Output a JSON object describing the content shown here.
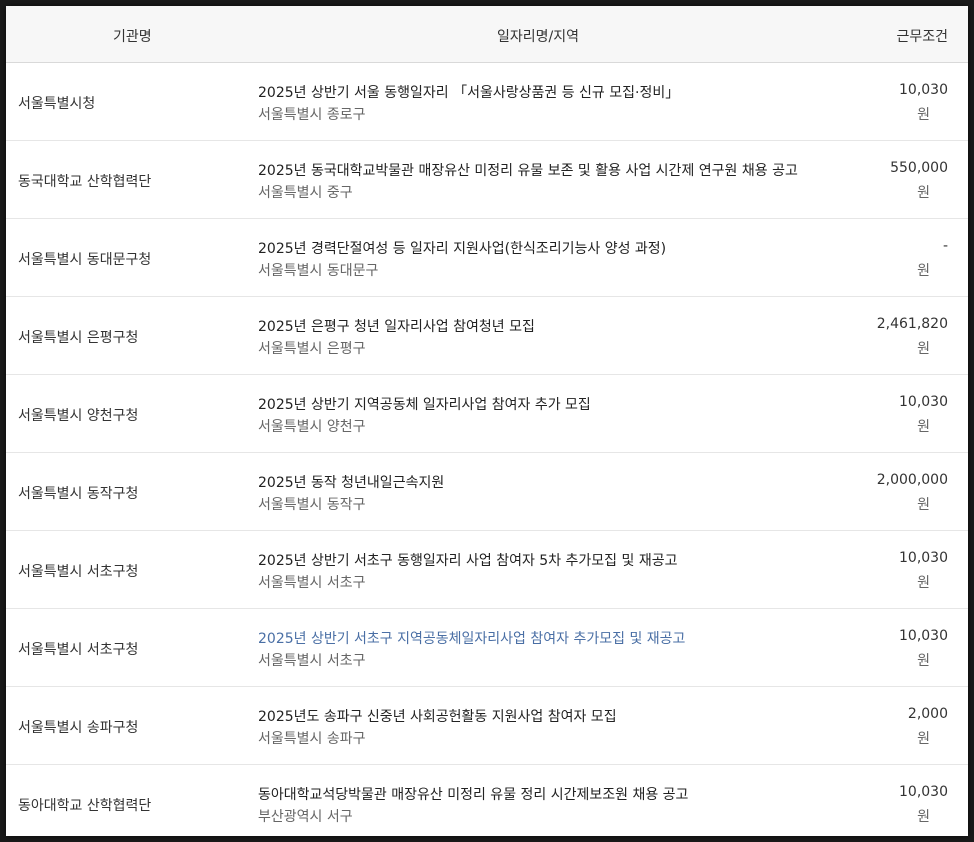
{
  "header": {
    "org": "기관명",
    "title": "일자리명/지역",
    "cond": "근무조건"
  },
  "rows": [
    {
      "org": "서울특별시청",
      "title": "2025년 상반기 서울 동행일자리 「서울사랑상품권 등 신규 모집·정비」",
      "region": "서울특별시 종로구",
      "amount": "10,030",
      "unit": "원"
    },
    {
      "org": "동국대학교 산학협력단",
      "title": "2025년 동국대학교박물관 매장유산 미정리 유물 보존 및 활용 사업 시간제 연구원 채용 공고",
      "region": "서울특별시 중구",
      "amount": "550,000",
      "unit": "원"
    },
    {
      "org": "서울특별시 동대문구청",
      "title": "2025년 경력단절여성 등 일자리 지원사업(한식조리기능사 양성 과정)",
      "region": "서울특별시 동대문구",
      "amount": "-",
      "unit": "원"
    },
    {
      "org": "서울특별시 은평구청",
      "title": "2025년 은평구 청년 일자리사업 참여청년 모집",
      "region": "서울특별시 은평구",
      "amount": "2,461,820",
      "unit": "원"
    },
    {
      "org": "서울특별시 양천구청",
      "title": "2025년 상반기 지역공동체 일자리사업 참여자 추가 모집",
      "region": "서울특별시 양천구",
      "amount": "10,030",
      "unit": "원"
    },
    {
      "org": "서울특별시 동작구청",
      "title": "2025년 동작 청년내일근속지원",
      "region": "서울특별시 동작구",
      "amount": "2,000,000",
      "unit": "원"
    },
    {
      "org": "서울특별시 서초구청",
      "title": "2025년 상반기 서초구 동행일자리 사업 참여자 5차 추가모집 및 재공고",
      "region": "서울특별시 서초구",
      "amount": "10,030",
      "unit": "원"
    },
    {
      "org": "서울특별시 서초구청",
      "title": "2025년 상반기 서초구 지역공동체일자리사업 참여자 추가모집 및 재공고",
      "region": "서울특별시 서초구",
      "amount": "10,030",
      "unit": "원"
    },
    {
      "org": "서울특별시 송파구청",
      "title": "2025년도 송파구 신중년 사회공헌활동 지원사업 참여자 모집",
      "region": "서울특별시 송파구",
      "amount": "2,000",
      "unit": "원"
    },
    {
      "org": "동아대학교 산학협력단",
      "title": "동아대학교석당박물관 매장유산 미정리 유물 정리 시간제보조원 채용 공고",
      "region": "부산광역시 서구",
      "amount": "10,030",
      "unit": "원"
    }
  ]
}
